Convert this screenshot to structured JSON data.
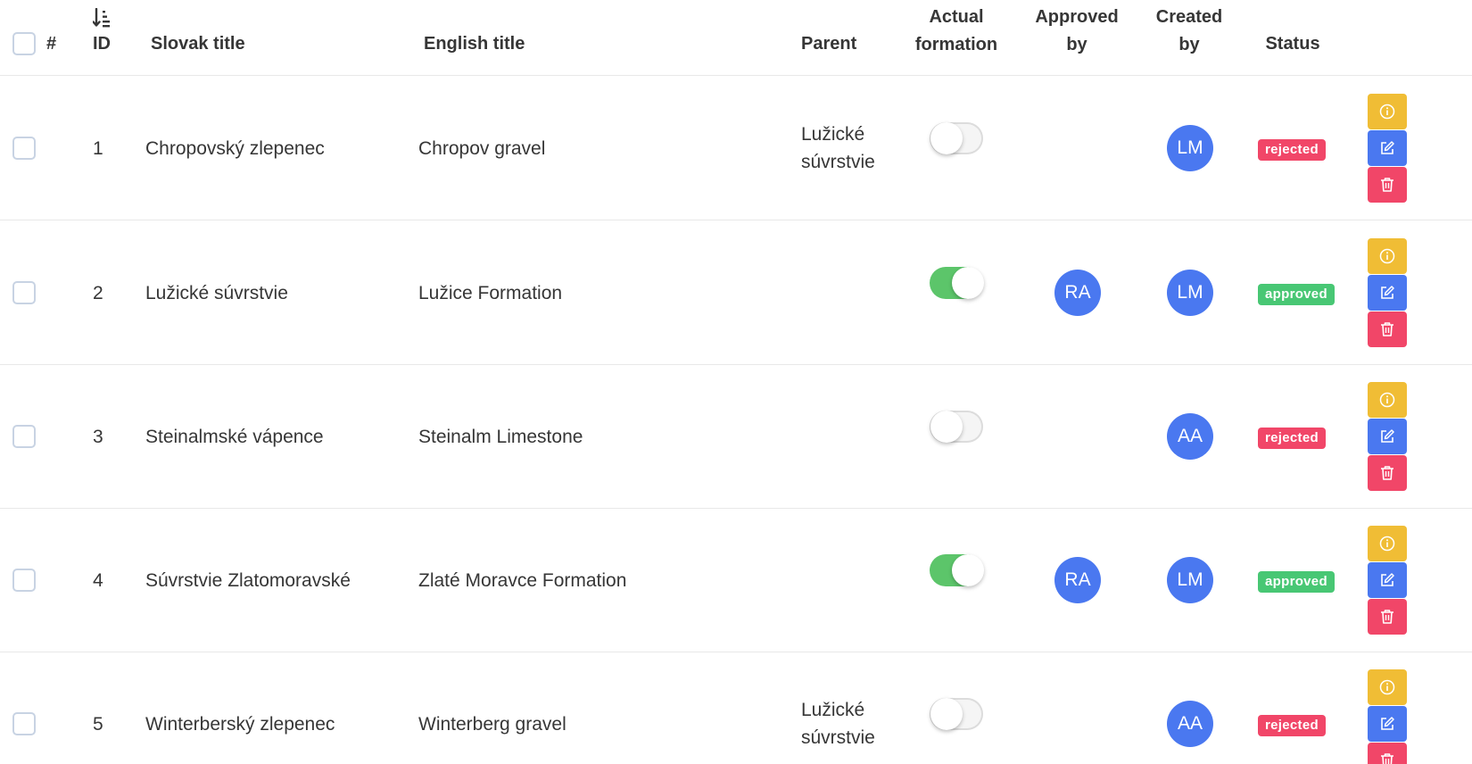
{
  "table": {
    "headers": {
      "hash": "#",
      "id": "ID",
      "slovak_title": "Slovak title",
      "english_title": "English title",
      "parent": "Parent",
      "actual_formation_1": "Actual",
      "actual_formation_2": "formation",
      "approved_by_1": "Approved",
      "approved_by_2": "by",
      "created_by_1": "Created",
      "created_by_2": "by",
      "status": "Status"
    },
    "rows": [
      {
        "id": "1",
        "slovak_title": "Chropovský zlepenec",
        "english_title": "Chropov gravel",
        "parent_line1": "Lužické",
        "parent_line2": "súvrstvie",
        "actual_formation": false,
        "approved_by": "",
        "created_by": "LM",
        "status": "rejected"
      },
      {
        "id": "2",
        "slovak_title": "Lužické súvrstvie",
        "english_title": "Lužice Formation",
        "parent_line1": "",
        "parent_line2": "",
        "actual_formation": true,
        "approved_by": "RA",
        "created_by": "LM",
        "status": "approved"
      },
      {
        "id": "3",
        "slovak_title": "Steinalmské vápence",
        "english_title": "Steinalm Limestone",
        "parent_line1": "",
        "parent_line2": "",
        "actual_formation": false,
        "approved_by": "",
        "created_by": "AA",
        "status": "rejected"
      },
      {
        "id": "4",
        "slovak_title": "Súvrstvie Zlatomoravské",
        "english_title": "Zlaté Moravce Formation",
        "parent_line1": "",
        "parent_line2": "",
        "actual_formation": true,
        "approved_by": "RA",
        "created_by": "LM",
        "status": "approved"
      },
      {
        "id": "5",
        "slovak_title": "Winterberský zlepenec",
        "english_title": "Winterberg gravel",
        "parent_line1": "Lužické",
        "parent_line2": "súvrstvie",
        "actual_formation": false,
        "approved_by": "",
        "created_by": "AA",
        "status": "rejected"
      }
    ]
  },
  "colors": {
    "approved": "#48c774",
    "rejected": "#f14668",
    "info_button": "#f0bd35",
    "edit_button": "#4a78f0",
    "delete_button": "#f14668",
    "avatar": "#4a78f0",
    "switch_on": "#5cc56a"
  },
  "icons": {
    "sort": "sort-numeric-down-icon",
    "info": "info-circle-icon",
    "edit": "edit-icon",
    "delete": "trash-icon"
  }
}
